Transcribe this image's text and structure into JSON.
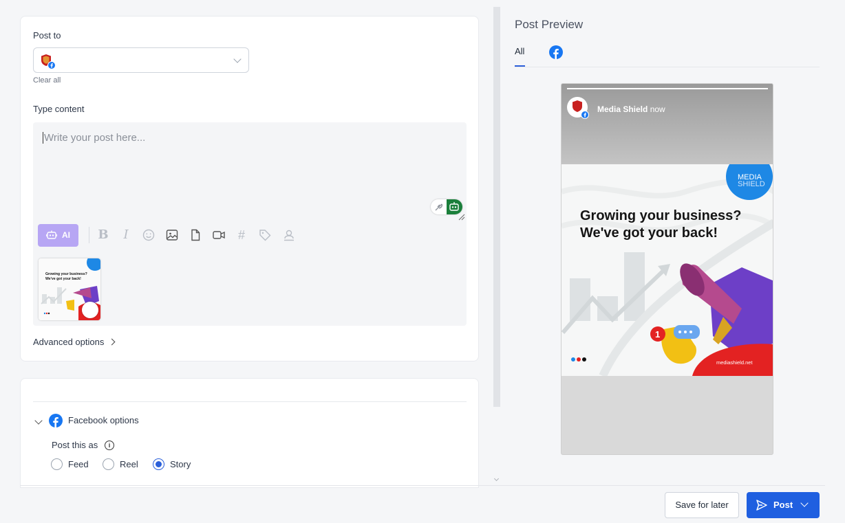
{
  "compose": {
    "post_to_label": "Post to",
    "clear_all": "Clear all",
    "type_content_label": "Type content",
    "editor_placeholder": "Write your post here...",
    "ai_label": "AI",
    "advanced_options": "Advanced options",
    "toolbar_icons": [
      "bold-icon",
      "italic-icon",
      "emoji-icon",
      "image-icon",
      "file-icon",
      "video-icon",
      "hashtag-icon",
      "tag-icon",
      "location-icon"
    ]
  },
  "facebook_options": {
    "title": "Facebook options",
    "post_as_label": "Post this as",
    "options": [
      "Feed",
      "Reel",
      "Story"
    ],
    "selected": "Story"
  },
  "preview": {
    "title": "Post Preview",
    "tab_all": "All",
    "account_name": "Media Shield",
    "time": "now",
    "creative": {
      "headline_1": "Growing your business?",
      "headline_2": "We've got your back!",
      "brand_1": "MEDIA",
      "brand_2": "SHIELD",
      "website": "mediashield.net",
      "badge": "1"
    }
  },
  "thumb": {
    "headline_1": "Growing your business?",
    "headline_2": "We've got your back!"
  },
  "actions": {
    "save_later": "Save for later",
    "post": "Post"
  },
  "colors": {
    "primary": "#1f5fe0",
    "ai": "#b7a6f4",
    "facebook": "#1877f2"
  }
}
